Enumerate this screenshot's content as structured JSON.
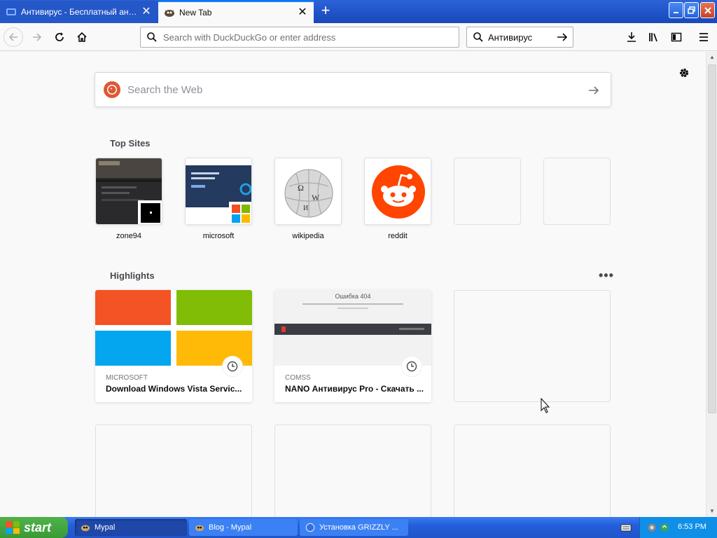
{
  "window": {
    "tabs": [
      {
        "title": "Антивирус - Бесплатный антив",
        "active": false
      },
      {
        "title": "New Tab",
        "active": true
      }
    ],
    "new_tab_symbol": "+"
  },
  "toolbar": {
    "url_placeholder": "Search with DuckDuckGo or enter address",
    "search_value": "Антивирус"
  },
  "newtab": {
    "web_search_placeholder": "Search the Web",
    "top_sites_title": "Top Sites",
    "top_sites": [
      {
        "label": "zone94"
      },
      {
        "label": "microsoft"
      },
      {
        "label": "wikipedia"
      },
      {
        "label": "reddit"
      },
      {
        "label": ""
      },
      {
        "label": ""
      }
    ],
    "highlights_title": "Highlights",
    "highlights_menu": "•••",
    "highlights": [
      {
        "source": "MICROSOFT",
        "title": "Download Windows Vista Servic..."
      },
      {
        "source": "COMSS",
        "title": "NANO Антивирус Pro - Скачать ..."
      },
      {
        "source": "",
        "title": ""
      }
    ],
    "comss_thumb_heading": "Ошибка 404"
  },
  "taskbar": {
    "start_label": "start",
    "tasks": [
      {
        "label": "Mypal"
      },
      {
        "label": "Blog - Mypal"
      },
      {
        "label": "Установка GRIZZLY ..."
      }
    ],
    "clock": "6:53 PM"
  },
  "colors": {
    "accent": "#0a84ff",
    "reddit": "#ff4500",
    "ddg": "#de5833",
    "xp_blue": "#245edb",
    "xp_green": "#3a9a37"
  }
}
